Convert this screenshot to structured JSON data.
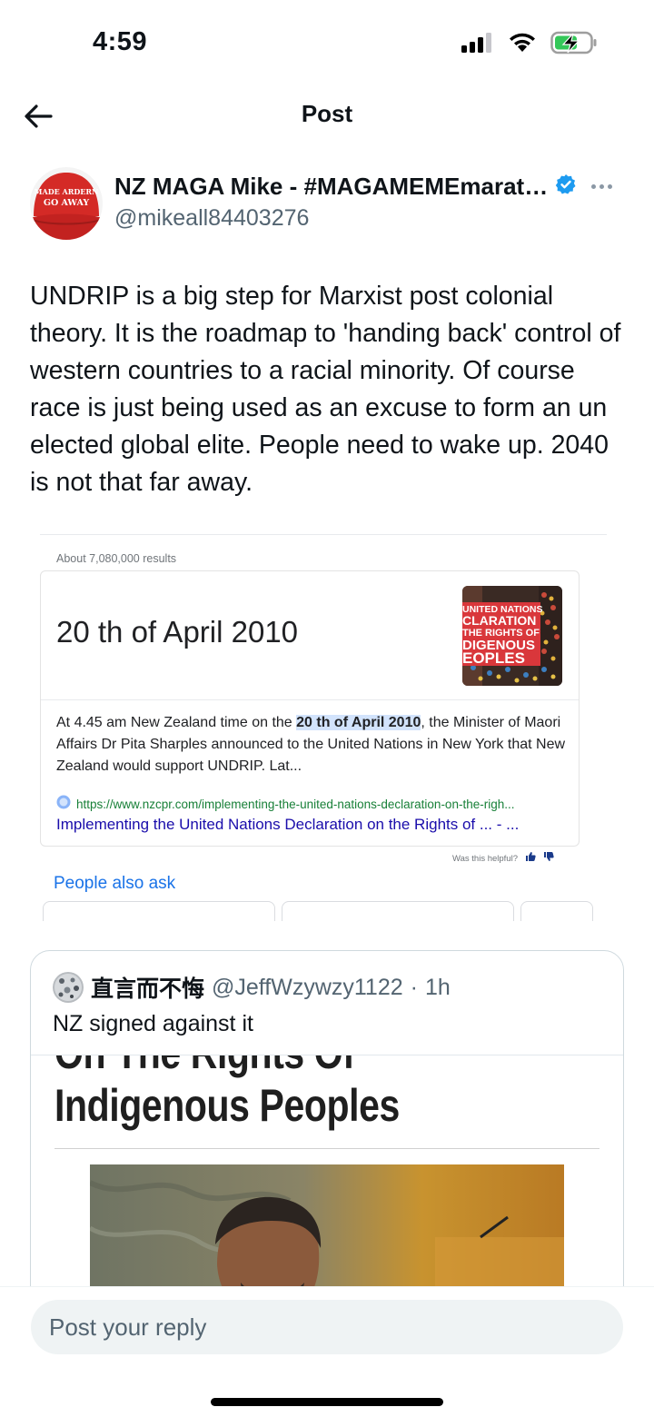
{
  "status_bar": {
    "time": "4:59",
    "icons": [
      "signal-icon",
      "wifi-icon",
      "battery-charging-icon"
    ]
  },
  "header": {
    "title": "Post",
    "back_icon": "arrow-left-icon"
  },
  "author": {
    "name": "NZ MAGA Mike - #MAGAMEMEmarat…",
    "handle": "@mikeall84403276",
    "verified": true,
    "avatar_line1": "MADE ARDERN",
    "avatar_line2": "GO AWAY"
  },
  "post": {
    "text": "UNDRIP is a big step for Marxist post colonial theory. It is the roadmap to 'handing back' control of western countries to a racial minority. Of course race is just being used as an excuse to form an un elected global elite. People need to wake up. 2040 is not that far away."
  },
  "embedded_search": {
    "results_count": "About 7,080,000 results",
    "featured_answer": "20 th of April 2010",
    "thumb_lines": [
      "UNITED NATIONS",
      "CLARATION",
      "THE RIGHTS OF",
      "DIGENOUS",
      "EOPLES"
    ],
    "body_before": "At 4.45 am New Zealand time on the ",
    "body_highlight": "20 th of April 2010",
    "body_after": ", the Minister of Maori Affairs Dr Pita Sharples announced to the United Nations in New York that New Zealand would support UNDRIP. Lat...",
    "url": "https://www.nzcpr.com/implementing-the-united-nations-declaration-on-the-righ...",
    "link_title": "Implementing the United Nations Declaration on the Rights of ... - ...",
    "helpful_text": "Was this helpful?",
    "people_also_ask": "People also ask"
  },
  "quote": {
    "name": "直言而不悔",
    "handle": "@JeffWzywzy1122",
    "separator": "·",
    "time": "1h",
    "text": "NZ signed against it",
    "media_headline_cut": "On The Rights Of",
    "media_headline": "Indigenous Peoples"
  },
  "reply": {
    "placeholder": "Post your reply"
  },
  "colors": {
    "text": "#0f1419",
    "secondary": "#536471",
    "verified_blue": "#1d9bf0",
    "search_link": "#1a0dab",
    "search_url": "#188038",
    "highlight": "#d2e3fc",
    "battery_green": "#34c759"
  }
}
